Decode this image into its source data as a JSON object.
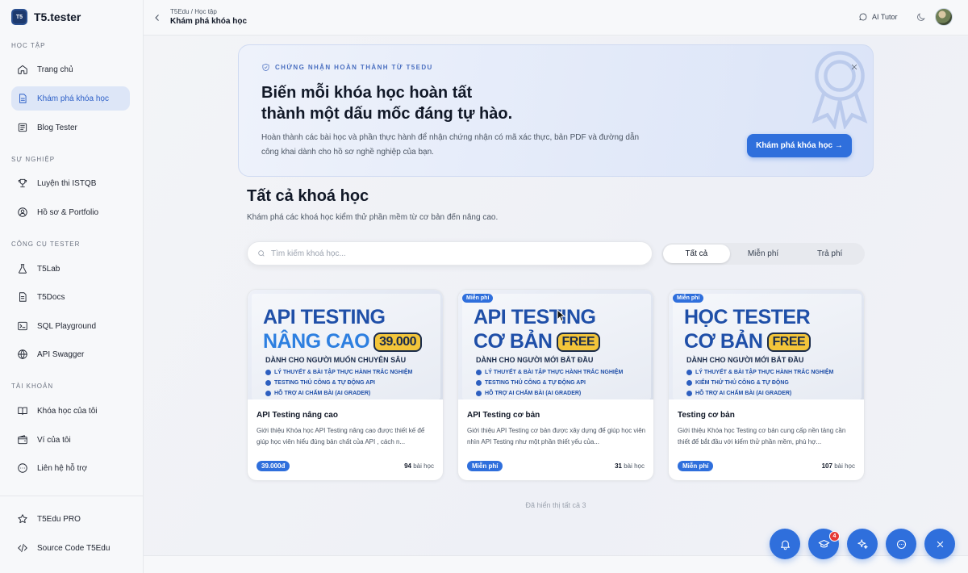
{
  "brand": {
    "logo": "T5",
    "name": "T5.tester"
  },
  "sidebar": {
    "sections": [
      {
        "label": "Học tập",
        "items": [
          {
            "label": "Trang chủ",
            "icon": "home-icon",
            "active": false
          },
          {
            "label": "Khám phá khóa học",
            "icon": "document-icon",
            "active": true
          },
          {
            "label": "Blog Tester",
            "icon": "newspaper-icon",
            "active": false
          }
        ]
      },
      {
        "label": "Sự nghiệp",
        "items": [
          {
            "label": "Luyện thi ISTQB",
            "icon": "trophy-icon",
            "active": false
          },
          {
            "label": "Hồ sơ & Portfolio",
            "icon": "user-circle-icon",
            "active": false
          }
        ]
      },
      {
        "label": "Công cụ tester",
        "items": [
          {
            "label": "T5Lab",
            "icon": "flask-icon",
            "active": false
          },
          {
            "label": "T5Docs",
            "icon": "file-icon",
            "active": false
          },
          {
            "label": "SQL Playground",
            "icon": "terminal-icon",
            "active": false
          },
          {
            "label": "API Swagger",
            "icon": "globe-icon",
            "active": false
          }
        ]
      },
      {
        "label": "Tài khoản",
        "items": [
          {
            "label": "Khóa học của tôi",
            "icon": "book-icon",
            "active": false
          },
          {
            "label": "Ví của tôi",
            "icon": "wallet-icon",
            "active": false
          },
          {
            "label": "Liên hệ hỗ trợ",
            "icon": "chat-icon",
            "active": false
          }
        ]
      }
    ],
    "footer_items": [
      {
        "label": "T5Edu PRO",
        "icon": "star-icon"
      },
      {
        "label": "Source Code T5Edu",
        "icon": "code-icon"
      }
    ]
  },
  "topbar": {
    "breadcrumb": "T5Edu / Học tập",
    "title": "Khám phá khóa học",
    "ai_tutor": "AI Tutor"
  },
  "banner": {
    "kicker": "Chứng nhận hoàn thành từ T5Edu",
    "heading_line1": "Biến mỗi khóa học hoàn tất",
    "heading_line2": "thành một dấu mốc đáng tự hào.",
    "description": "Hoàn thành các bài học và phần thực hành để nhận chứng nhận có mã xác thực, bản PDF và đường dẫn công khai dành cho hồ sơ nghề nghiệp của bạn.",
    "cta": "Khám phá khóa học →"
  },
  "courses_section": {
    "title": "Tất cả khoá học",
    "subtitle": "Khám phá các khoá học kiểm thử phần mềm từ cơ bản đến nâng cao.",
    "search_placeholder": "Tìm kiếm khoá học...",
    "filters": [
      "Tất cả",
      "Miễn phí",
      "Trả phí"
    ],
    "active_filter": "Tất cả",
    "shown_all": "Đã hiển thị tất cả 3"
  },
  "courses": [
    {
      "free_badge": "",
      "thumb_line1": "API TESTING",
      "thumb_line2": "NÂNG CAO",
      "thumb_price": "39.000",
      "thumb_subtitle": "DÀNH CHO NGƯỜI MUỐN CHUYÊN SÂU",
      "thumb_bullets": [
        "LÝ THUYẾT & BÀI TẬP THỰC HÀNH TRẮC NGHIỆM",
        "TESTING THỦ CÔNG & TỰ ĐỘNG API",
        "HỖ TRỢ AI CHẤM BÀI (AI GRADER)"
      ],
      "title": "API Testing nâng cao",
      "description": "Giới thiệu Khóa học API Testing nâng cao được thiết kế để giúp học viên hiểu đúng bản chất của API , cách n...",
      "price": "39.000đ",
      "lessons_count": "94",
      "lessons_label": "bài học"
    },
    {
      "free_badge": "Miễn phí",
      "thumb_line1": "API TESTING",
      "thumb_line2": "CƠ BẢN",
      "thumb_price": "FREE",
      "thumb_subtitle": "DÀNH CHO NGƯỜI MỚI BẮT ĐẦU",
      "thumb_bullets": [
        "LÝ THUYẾT & BÀI TẬP THỰC HÀNH TRẮC NGHIỆM",
        "TESTING THỦ CÔNG & TỰ ĐỘNG API",
        "HỖ TRỢ AI CHẤM BÀI (AI GRADER)"
      ],
      "title": "API Testing cơ bản",
      "description": "Giới thiệu API Testing cơ bản được xây dựng để giúp học viên nhìn API Testing như một phần thiết yếu của...",
      "price": "Miễn phí",
      "lessons_count": "31",
      "lessons_label": "bài học"
    },
    {
      "free_badge": "Miễn phí",
      "thumb_line1": "HỌC TESTER",
      "thumb_line2": "CƠ BẢN",
      "thumb_price": "FREE",
      "thumb_subtitle": "DÀNH CHO NGƯỜI MỚI BẮT ĐẦU",
      "thumb_bullets": [
        "LÝ THUYẾT & BÀI TẬP THỰC HÀNH TRẮC NGHIỆM",
        "KIỂM THỬ THỦ CÔNG & TỰ ĐỘNG",
        "HỖ TRỢ AI CHẤM BÀI (AI GRADER)"
      ],
      "title": "Testing cơ bản",
      "description": "Giới thiệu Khóa học Testing cơ bản cung cấp nền tảng cần thiết để bắt đầu với kiểm thử phần mềm, phù hợ...",
      "price": "Miễn phí",
      "lessons_count": "107",
      "lessons_label": "bài học"
    }
  ],
  "fabs": [
    {
      "icon": "bell-icon",
      "badge": ""
    },
    {
      "icon": "graduation-cap-icon",
      "badge": "4"
    },
    {
      "icon": "sparkles-icon",
      "badge": ""
    },
    {
      "icon": "message-icon",
      "badge": ""
    },
    {
      "icon": "close-icon",
      "badge": ""
    }
  ],
  "colors": {
    "accent": "#2f6fdc",
    "active_nav_bg": "#dde6f7",
    "badge_red": "#e53935"
  }
}
